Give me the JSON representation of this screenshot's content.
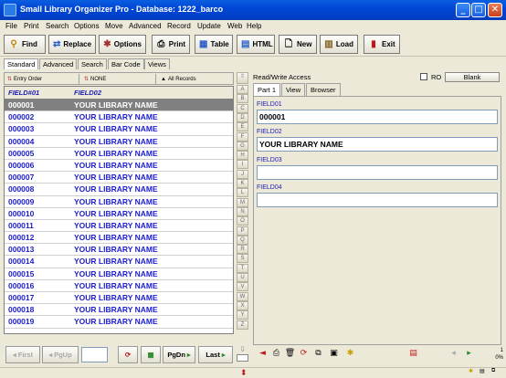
{
  "window": {
    "title": "Small Library Organizer Pro - Database: 1222_barco"
  },
  "menu": [
    "File",
    "Print",
    "Search",
    "Options",
    "Move",
    "Advanced",
    "Record",
    "Update",
    "Web",
    "Help"
  ],
  "toolbar": {
    "find": "Find",
    "replace": "Replace",
    "options": "Options",
    "print": "Print",
    "table": "Table",
    "html": "HTML",
    "new": "New",
    "load": "Load",
    "exit": "Exit"
  },
  "mode_tabs": [
    "Standard",
    "Advanced",
    "Search",
    "Bar Code",
    "Views"
  ],
  "sortbar": {
    "order": "Entry Order",
    "filter": "NONE",
    "records": "All Records"
  },
  "grid": {
    "columns": [
      "FIELD#01",
      "FIELD02"
    ],
    "rows": [
      [
        "000001",
        "YOUR LIBRARY NAME"
      ],
      [
        "000002",
        "YOUR LIBRARY NAME"
      ],
      [
        "000003",
        "YOUR LIBRARY NAME"
      ],
      [
        "000004",
        "YOUR LIBRARY NAME"
      ],
      [
        "000005",
        "YOUR LIBRARY NAME"
      ],
      [
        "000006",
        "YOUR LIBRARY NAME"
      ],
      [
        "000007",
        "YOUR LIBRARY NAME"
      ],
      [
        "000008",
        "YOUR LIBRARY NAME"
      ],
      [
        "000009",
        "YOUR LIBRARY NAME"
      ],
      [
        "000010",
        "YOUR LIBRARY NAME"
      ],
      [
        "000011",
        "YOUR LIBRARY NAME"
      ],
      [
        "000012",
        "YOUR LIBRARY NAME"
      ],
      [
        "000013",
        "YOUR LIBRARY NAME"
      ],
      [
        "000014",
        "YOUR LIBRARY NAME"
      ],
      [
        "000015",
        "YOUR LIBRARY NAME"
      ],
      [
        "000016",
        "YOUR LIBRARY NAME"
      ],
      [
        "000017",
        "YOUR LIBRARY NAME"
      ],
      [
        "000018",
        "YOUR LIBRARY NAME"
      ],
      [
        "000019",
        "YOUR LIBRARY NAME"
      ]
    ]
  },
  "alpha": [
    "A",
    "B",
    "C",
    "D",
    "E",
    "F",
    "G",
    "H",
    "I",
    "J",
    "K",
    "L",
    "M",
    "N",
    "O",
    "P",
    "Q",
    "R",
    "S",
    "T",
    "U",
    "V",
    "W",
    "X",
    "Y",
    "Z"
  ],
  "form": {
    "access": "Read/Write Access",
    "ro_label": "RO",
    "blank_button": "Blank",
    "tabs": [
      "Part 1",
      "View",
      "Browser"
    ],
    "fields": [
      {
        "label": "FIELD01",
        "value": "000001"
      },
      {
        "label": "FIELD02",
        "value": "YOUR LIBRARY NAME"
      },
      {
        "label": "FIELD03",
        "value": ""
      },
      {
        "label": "FIELD04",
        "value": ""
      }
    ]
  },
  "nav": {
    "first": "First",
    "pgup": "PgUp",
    "pgdn": "PgDn",
    "last": "Last",
    "record_input": ""
  },
  "status": {
    "counter": "1",
    "percent": "0%"
  }
}
